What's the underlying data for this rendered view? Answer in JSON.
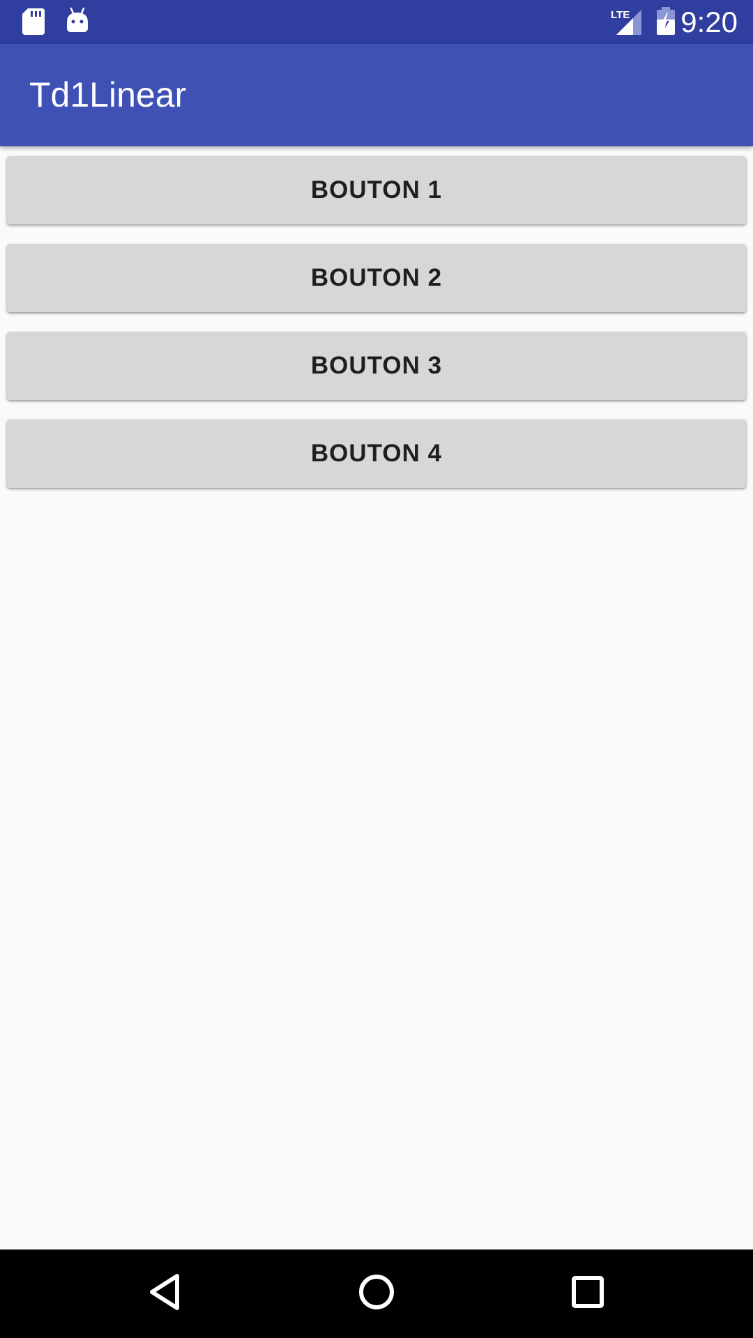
{
  "status_bar": {
    "time": "9:20",
    "network_label": "LTE",
    "icons": [
      "sd-card-icon",
      "android-icon",
      "lte-signal-icon",
      "battery-charging-icon"
    ],
    "background_color": "#303F9F"
  },
  "app_bar": {
    "title": "Td1Linear",
    "background_color": "#3F51B5"
  },
  "buttons": [
    {
      "label": "BOUTON 1"
    },
    {
      "label": "BOUTON 2"
    },
    {
      "label": "BOUTON 3"
    },
    {
      "label": "BOUTON 4"
    }
  ],
  "nav_bar": {
    "icons": [
      "back-icon",
      "home-icon",
      "recents-icon"
    ]
  }
}
